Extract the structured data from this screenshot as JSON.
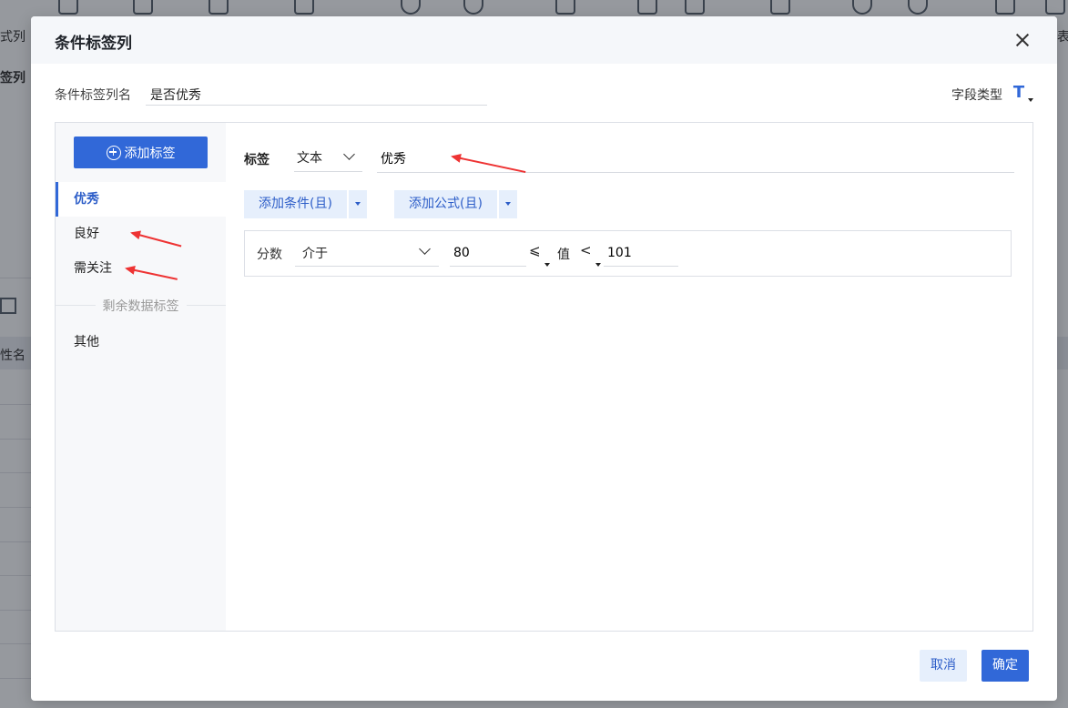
{
  "background": {
    "left_labels": [
      "式列",
      "签列",
      "性名"
    ],
    "right_labels": [
      "表行"
    ]
  },
  "dialog": {
    "title": "条件标签列",
    "name_label": "条件标签列名",
    "name_value": "是否优秀",
    "field_type_label": "字段类型",
    "field_type_icon": "T",
    "add_tag_label": "添加标签",
    "tags": [
      "优秀",
      "良好",
      "需关注"
    ],
    "active_tag": "优秀",
    "remaining_label": "剩余数据标签",
    "remaining_tag": "其他",
    "tag_label": "标签",
    "tag_type": "文本",
    "tag_value": "优秀",
    "add_condition_label": "添加条件(且)",
    "add_formula_label": "添加公式(且)",
    "condition": {
      "field": "分数",
      "operator": "介于",
      "min": "80",
      "min_op": "⩽",
      "value_word": "值",
      "max_op": "<",
      "max": "101"
    },
    "cancel_label": "取消",
    "ok_label": "确定"
  },
  "colors": {
    "primary": "#3168d8",
    "light": "#e6effc",
    "annotation": "#ee3333"
  }
}
